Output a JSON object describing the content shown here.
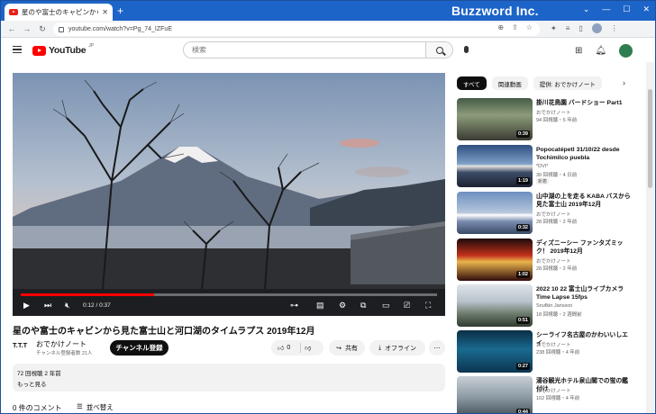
{
  "browser": {
    "tab_title": "星のや富士のキャピンから見た富士山と河口湖のタイムラプス 2019年12月 - YouTube",
    "new_tab": "+",
    "brand": "Buzzword Inc.",
    "url": "youtube.com/watch?v=Pg_74_IZFuE"
  },
  "header": {
    "logo_text": "YouTube",
    "logo_region": "JP",
    "search_placeholder": "検索"
  },
  "player": {
    "time": "0:12 / 0:37",
    "progress_fraction": 0.32
  },
  "video": {
    "title": "星のや富士のキャビンから見た富士山と河口湖のタイムラプス 2019年12月",
    "channel_icon": "T.T.T",
    "channel_name": "おでかけノート",
    "subscribers": "チャンネル登録者数 21人",
    "subscribe_label": "チャンネル登録",
    "like_count": "0",
    "share_label": "共有",
    "offline_label": "オフライン",
    "meta": "72 回視聴  2 年前",
    "more_label": "もっと見る",
    "comments_label": "0 件のコメント",
    "sort_label": "並べ替え"
  },
  "chips": [
    "すべて",
    "関連動画",
    "提供: おでかけノート"
  ],
  "recommendations": [
    {
      "title": "掛川花鳥園 バードショー Part1",
      "channel": "おでかけノート",
      "meta": "94 回視聴・5 年前",
      "duration": "0:39",
      "badge": ""
    },
    {
      "title": "Popocatépetl 31/10/22 desde Tochimilco puebla",
      "channel": "*DVI*",
      "meta": "30 回視聴・4 日前",
      "duration": "1:19",
      "badge": "新着"
    },
    {
      "title": "山中湖の上を走る KABA バスから見た富士山 2019年12月",
      "channel": "おでかけノート",
      "meta": "28 回視聴・2 年前",
      "duration": "0:32",
      "badge": ""
    },
    {
      "title": "ディズニーシー ファンタズミック！ 2019年12月",
      "channel": "おでかけノート",
      "meta": "28 回視聴・2 年前",
      "duration": "1:02",
      "badge": ""
    },
    {
      "title": "2022 10 22 富士山ライブカメラ Time Lapse 15fps",
      "channel": "Snufkin Jansson",
      "meta": "18 回視聴・2 週間前",
      "duration": "0:51",
      "badge": ""
    },
    {
      "title": "シーライフ名古屋のかわいいしエイ",
      "channel": "おでかけノート",
      "meta": "238 回視聴・4 年前",
      "duration": "0:27",
      "badge": ""
    },
    {
      "title": "湯谷観光ホテル泉山閣での蛍の鑑付け",
      "channel": "おでかけノート",
      "meta": "102 回視聴・4 年前",
      "duration": "0:44",
      "badge": ""
    }
  ]
}
